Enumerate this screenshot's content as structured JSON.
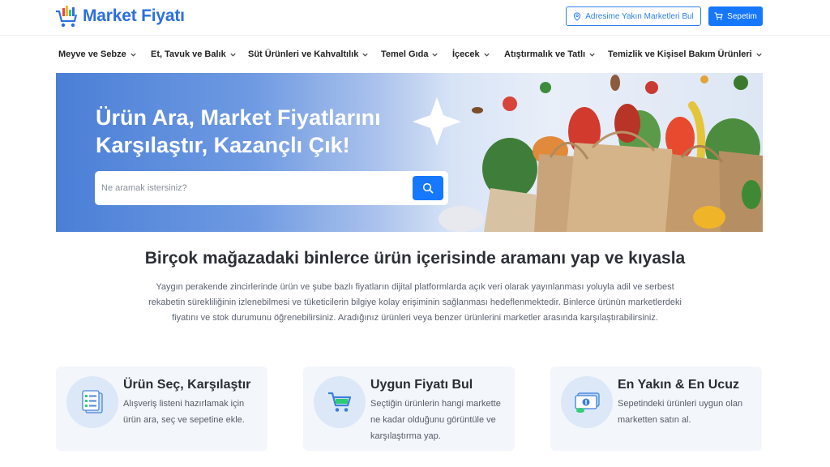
{
  "header": {
    "logo_text": "Market Fiyatı",
    "nearby_button": "Adresime Yakın Marketleri Bul",
    "cart_button": "Sepetim"
  },
  "nav": {
    "items": [
      {
        "label": "Meyve ve Sebze"
      },
      {
        "label": "Et, Tavuk ve Balık"
      },
      {
        "label": "Süt Ürünleri ve Kahvaltılık"
      },
      {
        "label": "Temel Gıda"
      },
      {
        "label": "İçecek"
      },
      {
        "label": "Atıştırmalık ve Tatlı"
      },
      {
        "label": "Temizlik ve Kişisel Bakım Ürünleri"
      }
    ]
  },
  "hero": {
    "title_line1": "Ürün Ara, Market Fiyatlarını",
    "title_line2": "Karşılaştır, Kazançlı Çık!",
    "search_placeholder": "Ne aramak istersiniz?"
  },
  "intro": {
    "title": "Birçok mağazadaki binlerce ürün içerisinde aramanı yap ve kıyasla",
    "text": "Yaygın perakende zincirlerinde ürün ve şube bazlı fiyatların dijital platformlarda açık veri olarak yayınlanması yoluyla adil ve serbest rekabetin sürekliliğinin izlenebilmesi ve tüketicilerin bilgiye kolay erişiminin sağlanması hedeflenmektedir. Binlerce ürünün marketlerdeki fiyatını ve stok durumunu öğrenebilirsiniz. Aradığınız ürünleri veya benzer ürünlerini marketler arasında karşılaştırabilirsiniz."
  },
  "features": [
    {
      "title": "Ürün Seç, Karşılaştır",
      "text": "Alışveriş listeni hazırlamak için ürün ara, seç ve sepetine ekle.",
      "icon": "checklist-icon"
    },
    {
      "title": "Uygun Fiyatı Bul",
      "text": "Seçtiğin ürünlerin hangi markette ne kadar olduğunu görüntüle ve karşılaştırma yap.",
      "icon": "cart-icon"
    },
    {
      "title": "En Yakın & En Ucuz",
      "text": "Sepetindeki ürünleri uygun olan marketten satın al.",
      "icon": "money-icon"
    }
  ],
  "colors": {
    "brand": "#2b6fe0",
    "primary_button": "#1677ff",
    "card_background": "#f3f6fb"
  }
}
